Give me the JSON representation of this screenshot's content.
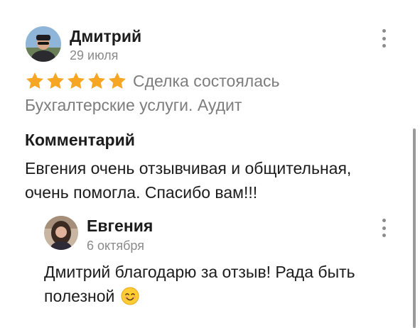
{
  "review": {
    "author": "Дмитрий",
    "date": "29 июля",
    "rating": 5,
    "deal_status": "Сделка состоялась",
    "category": "Бухгалтерские услуги. Аудит",
    "comment_heading": "Комментарий",
    "comment_text": "Евгения очень отзывчивая и общительная, очень помогла. Спасибо вам!!!"
  },
  "reply": {
    "author": "Евгения",
    "date": "6 октября",
    "text": "Дмитрий благодарю за отзыв! Рада быть полезной",
    "emoji": "smiling-face-emoji"
  },
  "colors": {
    "star": "#f6a623",
    "muted_text": "#7d7d7d",
    "text": "#1c1c1c"
  }
}
